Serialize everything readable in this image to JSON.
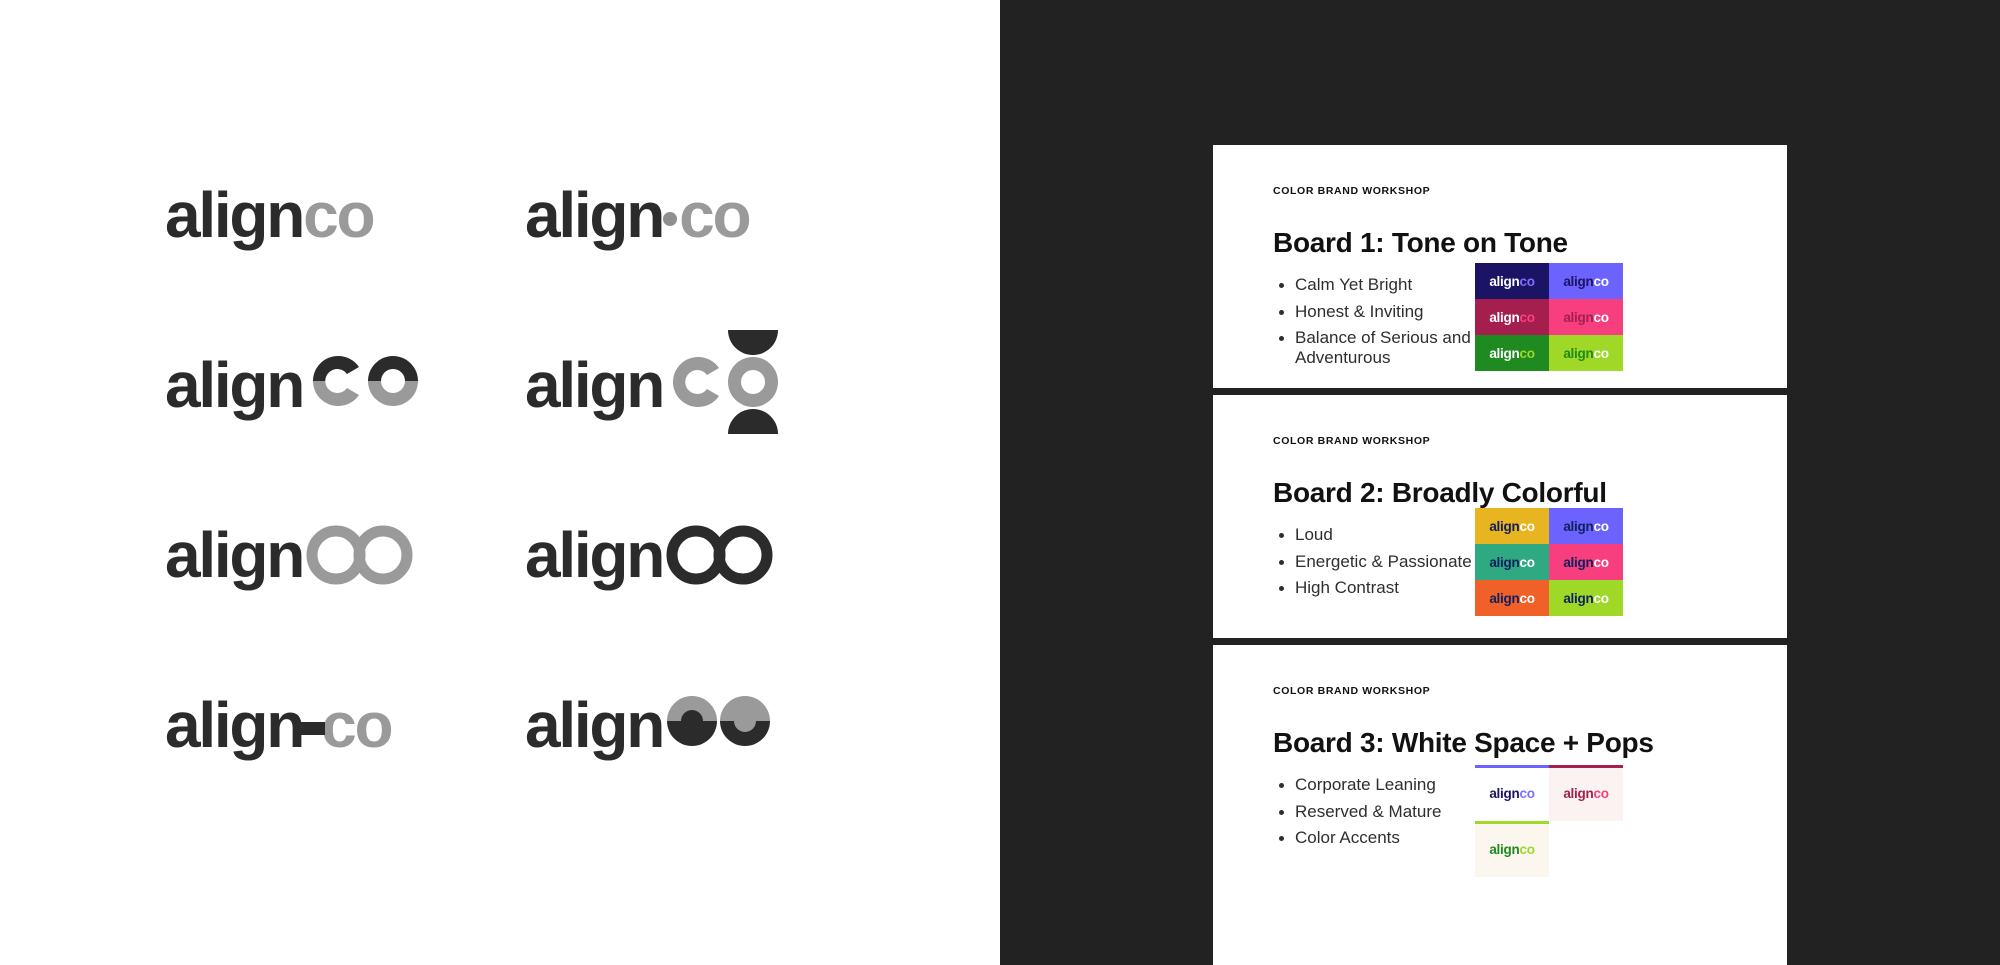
{
  "brand": {
    "word_primary": "align",
    "word_secondary": "co",
    "full": "alignco",
    "ink": "#2b2b2b",
    "muted": "#9a9a9a"
  },
  "logo_panel": {
    "background": "#ffffff",
    "variants": [
      {
        "id": "v1",
        "row": 1,
        "col": 1,
        "style": "plain-grey-co",
        "align": "align",
        "co": "co",
        "note": "solid grey co"
      },
      {
        "id": "v2",
        "row": 1,
        "col": 2,
        "style": "dot-separator",
        "align": "align",
        "co": "co",
        "note": "dot between align and co"
      },
      {
        "id": "v3",
        "row": 2,
        "col": 1,
        "style": "split-horizontal-co",
        "align": "align",
        "co": "co",
        "note": "co split dark top / grey bottom"
      },
      {
        "id": "v4",
        "row": 2,
        "col": 2,
        "style": "hourglass-co",
        "align": "align",
        "co": "co",
        "note": "semicircles above and below the o"
      },
      {
        "id": "v5",
        "row": 3,
        "col": 1,
        "style": "outline-rings-grey",
        "align": "align",
        "co": "co",
        "note": "overlapping grey outline rings"
      },
      {
        "id": "v6",
        "row": 3,
        "col": 2,
        "style": "outline-rings-dark",
        "align": "align",
        "co": "co",
        "note": "overlapping dark outline rings"
      },
      {
        "id": "v7",
        "row": 4,
        "col": 1,
        "style": "dash-connector",
        "align": "align",
        "co": "co",
        "note": "dash linking align to co"
      },
      {
        "id": "v8",
        "row": 4,
        "col": 2,
        "style": "split-dark-grey-discs",
        "align": "align",
        "co": "co",
        "note": "two discs split dark/grey"
      }
    ]
  },
  "deck_panel": {
    "background": "#222222",
    "slide_background": "#ffffff",
    "boards": [
      {
        "eyebrow": "COLOR BRAND WORKSHOP",
        "title": "Board 1: Tone on Tone",
        "bullets": [
          "Calm Yet Bright",
          "Honest & Inviting",
          "Balance of Serious and Adventurous"
        ],
        "swatch_style": "grid",
        "swatches": [
          {
            "bg": "#1b1464",
            "align_color": "#ffffff",
            "co_color": "#7b6fff"
          },
          {
            "bg": "#6c63ff",
            "align_color": "#1b1464",
            "co_color": "#ffffff"
          },
          {
            "bg": "#a51f4e",
            "align_color": "#ffffff",
            "co_color": "#ff3d7f"
          },
          {
            "bg": "#f73e7e",
            "align_color": "#a51f4e",
            "co_color": "#ffffff"
          },
          {
            "bg": "#1f8a1f",
            "align_color": "#ffffff",
            "co_color": "#9fd826"
          },
          {
            "bg": "#9fd826",
            "align_color": "#1f8a1f",
            "co_color": "#ffffff"
          }
        ]
      },
      {
        "eyebrow": "COLOR BRAND WORKSHOP",
        "title": "Board 2: Broadly Colorful",
        "bullets": [
          "Loud",
          "Energetic & Passionate",
          "High Contrast"
        ],
        "swatch_style": "grid",
        "swatches": [
          {
            "bg": "#e8b420",
            "align_color": "#10205e",
            "co_color": "#ffffff"
          },
          {
            "bg": "#6c63ff",
            "align_color": "#10205e",
            "co_color": "#ffffff"
          },
          {
            "bg": "#2fa981",
            "align_color": "#10205e",
            "co_color": "#ffffff"
          },
          {
            "bg": "#f73e7e",
            "align_color": "#10205e",
            "co_color": "#ffffff"
          },
          {
            "bg": "#f0612a",
            "align_color": "#10205e",
            "co_color": "#ffffff"
          },
          {
            "bg": "#9fd826",
            "align_color": "#10205e",
            "co_color": "#ffffff"
          }
        ]
      },
      {
        "eyebrow": "COLOR BRAND WORKSHOP",
        "title": "Board 3: White Space + Pops",
        "bullets": [
          "Corporate Leaning",
          "Reserved & Mature",
          "Color Accents"
        ],
        "swatch_style": "pops",
        "pops": [
          {
            "rule": "#6c63ff",
            "bg": "#ffffff",
            "align_color": "#1b1464",
            "co_color": "#7b6fff"
          },
          {
            "rule": "#a51f4e",
            "bg": "#fbf2f2",
            "align_color": "#a51f4e",
            "co_color": "#f73e7e"
          },
          {
            "rule": "#9fd826",
            "bg": "#fbf6ee",
            "align_color": "#1f8a1f",
            "co_color": "#9fd826"
          },
          {
            "rule": null,
            "bg": null,
            "align_color": null,
            "co_color": null
          }
        ]
      }
    ]
  }
}
